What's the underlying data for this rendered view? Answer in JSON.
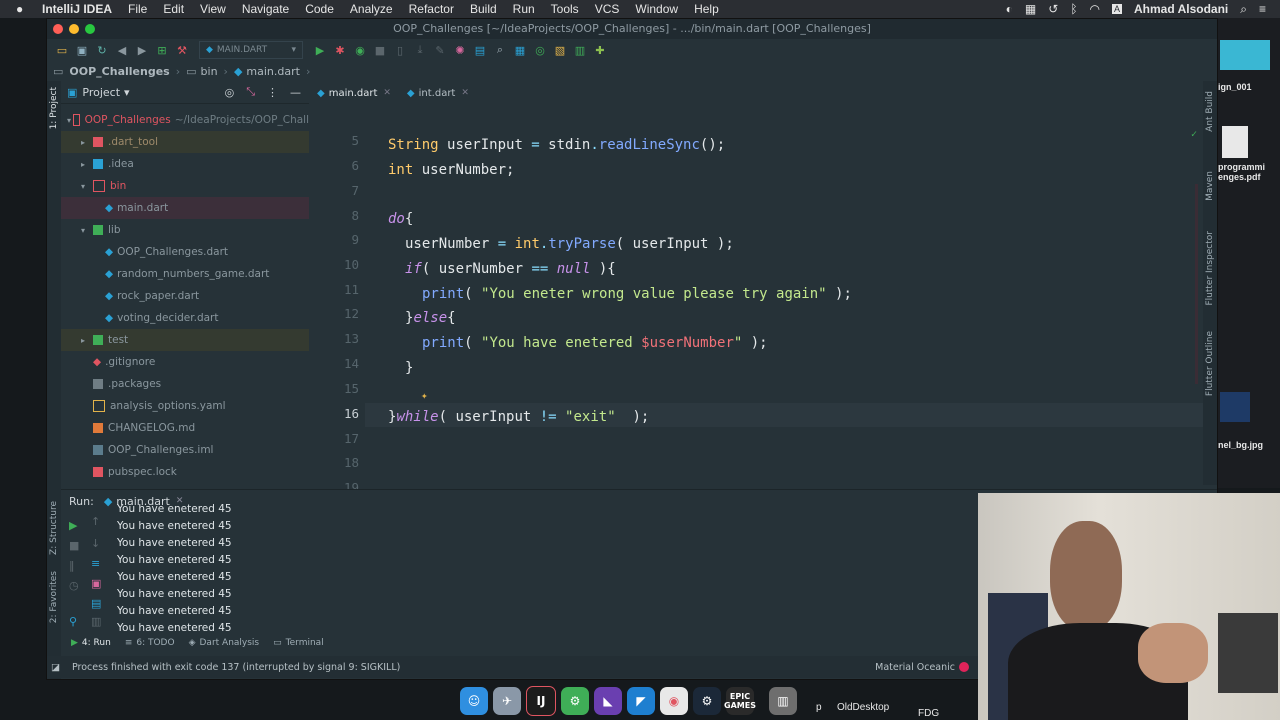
{
  "menubar": {
    "app": "IntelliJ IDEA",
    "items": [
      "File",
      "Edit",
      "View",
      "Navigate",
      "Code",
      "Analyze",
      "Refactor",
      "Build",
      "Run",
      "Tools",
      "VCS",
      "Window",
      "Help"
    ],
    "user": "Ahmad Alsodani"
  },
  "window": {
    "title": "OOP_Challenges [~/IdeaProjects/OOP_Challenges] - .../bin/main.dart [OOP_Challenges]"
  },
  "toolbar": {
    "run_config": "MAIN.DART"
  },
  "breadcrumb": [
    "OOP_Challenges",
    "bin",
    "main.dart"
  ],
  "stripe": {
    "project": "1: Project",
    "structure": "Z: Structure",
    "favorites": "2: Favorites",
    "ant": "Ant Build",
    "maven": "Maven",
    "flutter_inspector": "Flutter Inspector",
    "flutter_outline": "Flutter Outline"
  },
  "project_panel": {
    "title": "Project",
    "root": {
      "name": "OOP_Challenges",
      "path": "~/IdeaProjects/OOP_Chall"
    },
    "items": [
      {
        "label": ".dart_tool",
        "color": "#9e8a6a"
      },
      {
        "label": ".idea",
        "color": "#8a979e"
      },
      {
        "label": "bin",
        "color": "#e05561"
      },
      {
        "label": "main.dart",
        "color": "#8a979e"
      },
      {
        "label": "lib",
        "color": "#8a979e"
      },
      {
        "label": "OOP_Challenges.dart",
        "color": "#8a979e"
      },
      {
        "label": "random_numbers_game.dart",
        "color": "#8a979e"
      },
      {
        "label": "rock_paper.dart",
        "color": "#8a979e"
      },
      {
        "label": "voting_decider.dart",
        "color": "#8a979e"
      },
      {
        "label": "test",
        "color": "#8a979e"
      },
      {
        "label": ".gitignore",
        "color": "#8a979e"
      },
      {
        "label": ".packages",
        "color": "#8a979e"
      },
      {
        "label": "analysis_options.yaml",
        "color": "#8a979e"
      },
      {
        "label": "CHANGELOG.md",
        "color": "#8a979e"
      },
      {
        "label": "OOP_Challenges.iml",
        "color": "#8a979e"
      },
      {
        "label": "pubspec.lock",
        "color": "#8a979e"
      }
    ]
  },
  "editor": {
    "tabs": [
      {
        "label": "main.dart"
      },
      {
        "label": "int.dart"
      }
    ],
    "line_numbers": [
      "5",
      "6",
      "7",
      "8",
      "9",
      "10",
      "11",
      "12",
      "13",
      "14",
      "15",
      "16",
      "17",
      "18",
      "19"
    ],
    "current_line": "16"
  },
  "code": {
    "l5_type": "String",
    "l5_var": "userInput",
    "l5_op": " = ",
    "l5_obj": "stdin",
    "l5_dot": ".",
    "l5_fn": "readLineSync",
    "l5_end": "();",
    "l6_type": "int",
    "l6_var": "userNumber;",
    "l8_kw": "do",
    "l8_end": "{",
    "l9_var": "userNumber",
    "l9_op": " = ",
    "l9_type": "int",
    "l9_dot": ".",
    "l9_fn": "tryParse",
    "l9_args": "( userInput );",
    "l10_kw": "if",
    "l10_a": "( userNumber ",
    "l10_op": "==",
    "l10_sp": " ",
    "l10_null": "null",
    "l10_end": " ){",
    "l11_fn": "print",
    "l11_a": "( ",
    "l11_str": "\"You eneter wrong value please try again\"",
    "l11_end": " );",
    "l12_a": "}",
    "l12_kw": "else",
    "l12_end": "{",
    "l13_fn": "print",
    "l13_a": "( ",
    "l13_str": "\"You have enetered ",
    "l13_var": "$userNumber",
    "l13_str2": "\"",
    "l13_end": " );",
    "l14": "}",
    "l16_a": "}",
    "l16_kw": "while",
    "l16_b": "( userInput ",
    "l16_op": "!=",
    "l16_sp": " ",
    "l16_str": "\"exit\"",
    "l16_end": "  );"
  },
  "run_panel": {
    "label": "Run:",
    "tab": "main.dart",
    "output": [
      "You have enetered 45",
      "You have enetered 45",
      "You have enetered 45",
      "You have enetered 45",
      "You have enetered 45",
      "You have enetered 45",
      "You have enetered 45",
      "You have enetered 45"
    ]
  },
  "bottom_tabs": [
    "4: Run",
    "6: TODO",
    "Dart Analysis",
    "Terminal"
  ],
  "status": {
    "message": "Process finished with exit code 137 (interrupted by signal 9: SIGKILL)",
    "theme": "Material Oceanic"
  },
  "desktop": {
    "labels": [
      "ign_001",
      "programmi\nenges.pdf",
      "nel_bg.jpg"
    ],
    "bottom": [
      "p",
      "OldDesktop",
      "FDG"
    ]
  },
  "dock": {
    "epic": "EPIC\nGAMES"
  }
}
